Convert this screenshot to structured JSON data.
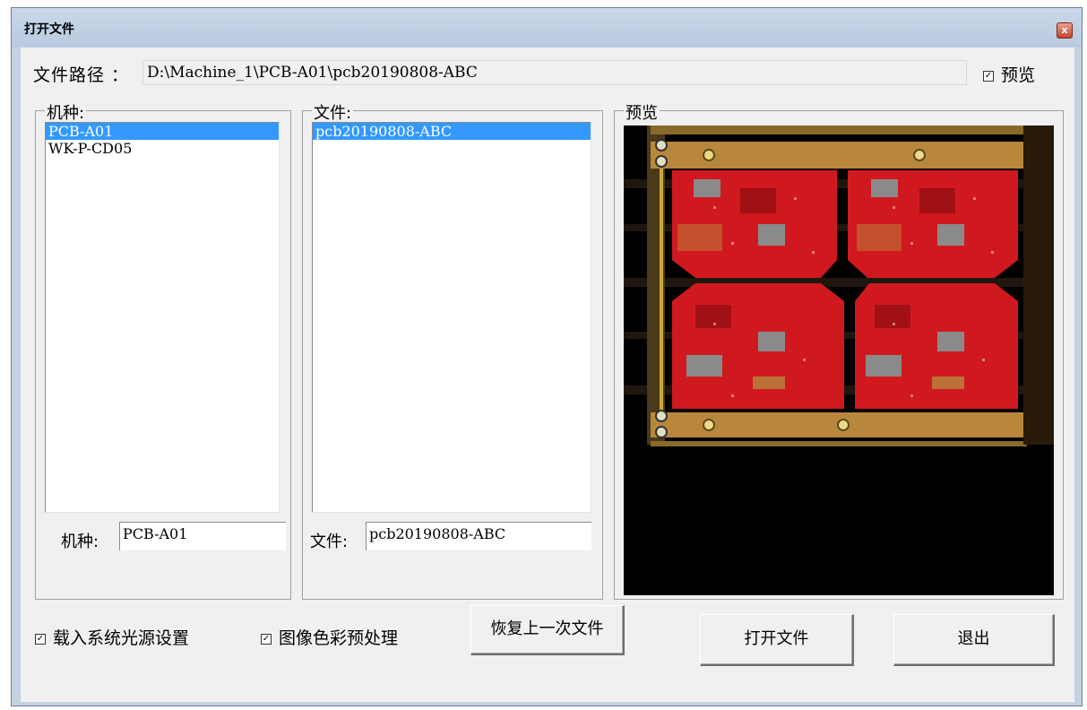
{
  "window": {
    "title": "打开文件",
    "close_glyph": "x"
  },
  "path": {
    "label": "文件路径 ：",
    "value": "D:\\Machine_1\\PCB-A01\\pcb20190808-ABC"
  },
  "preview_checkbox": {
    "label": "预览",
    "checked": true,
    "check_glyph": "✓"
  },
  "machine_group": {
    "title": "机种:",
    "items": [
      {
        "label": "PCB-A01",
        "selected": true
      },
      {
        "label": "WK-P-CD05",
        "selected": false
      }
    ],
    "field_label": "机种:",
    "field_value": "PCB-A01"
  },
  "file_group": {
    "title": "文件:",
    "items": [
      {
        "label": "pcb20190808-ABC",
        "selected": true
      }
    ],
    "field_label": "文件:",
    "field_value": "pcb20190808-ABC"
  },
  "preview_group": {
    "title": "预览"
  },
  "options": {
    "load_light": {
      "label": "载入系统光源设置",
      "checked": true
    },
    "color_preprocess": {
      "label": "图像色彩预处理",
      "checked": true
    }
  },
  "buttons": {
    "restore": "恢复上一次文件",
    "open": "打开文件",
    "exit": "退出"
  },
  "colors": {
    "selection": "#3399ff",
    "pcb_red": "#d0191f",
    "pcb_copper": "#b8873c",
    "background": "#f0f0f0"
  }
}
